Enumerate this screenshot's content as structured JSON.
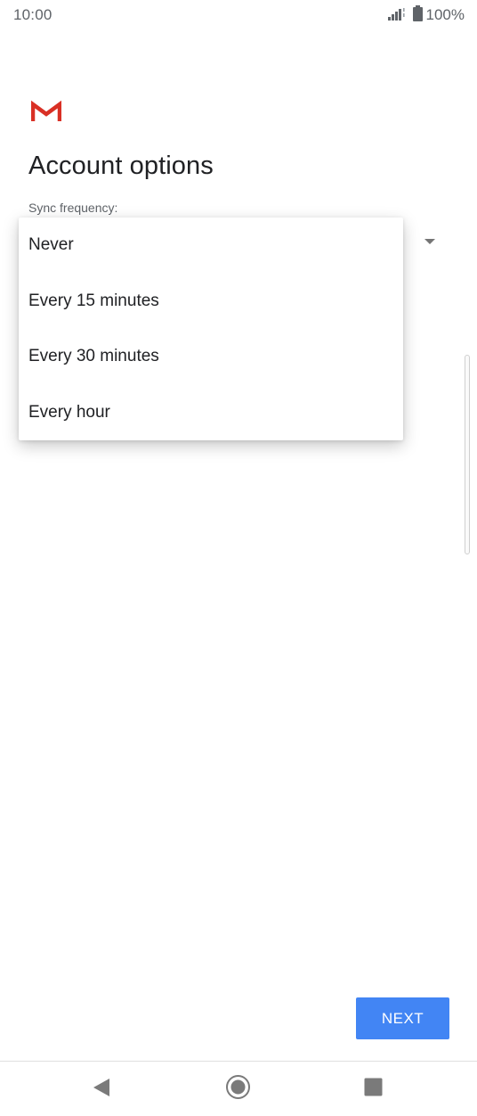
{
  "status_bar": {
    "time": "10:00",
    "battery": "100%",
    "icons": [
      "signal-icon",
      "battery-icon"
    ]
  },
  "app": {
    "logo": "gmail-logo",
    "colors": {
      "accent": "#4285f4",
      "gmail_red": "#d93025"
    }
  },
  "page": {
    "title": "Account options"
  },
  "sync": {
    "label": "Sync frequency:",
    "options": [
      "Never",
      "Every 15 minutes",
      "Every 30 minutes",
      "Every hour"
    ]
  },
  "actions": {
    "next_label": "NEXT"
  },
  "nav_bar": {
    "icons": [
      "back-icon",
      "home-icon",
      "recents-icon"
    ]
  }
}
